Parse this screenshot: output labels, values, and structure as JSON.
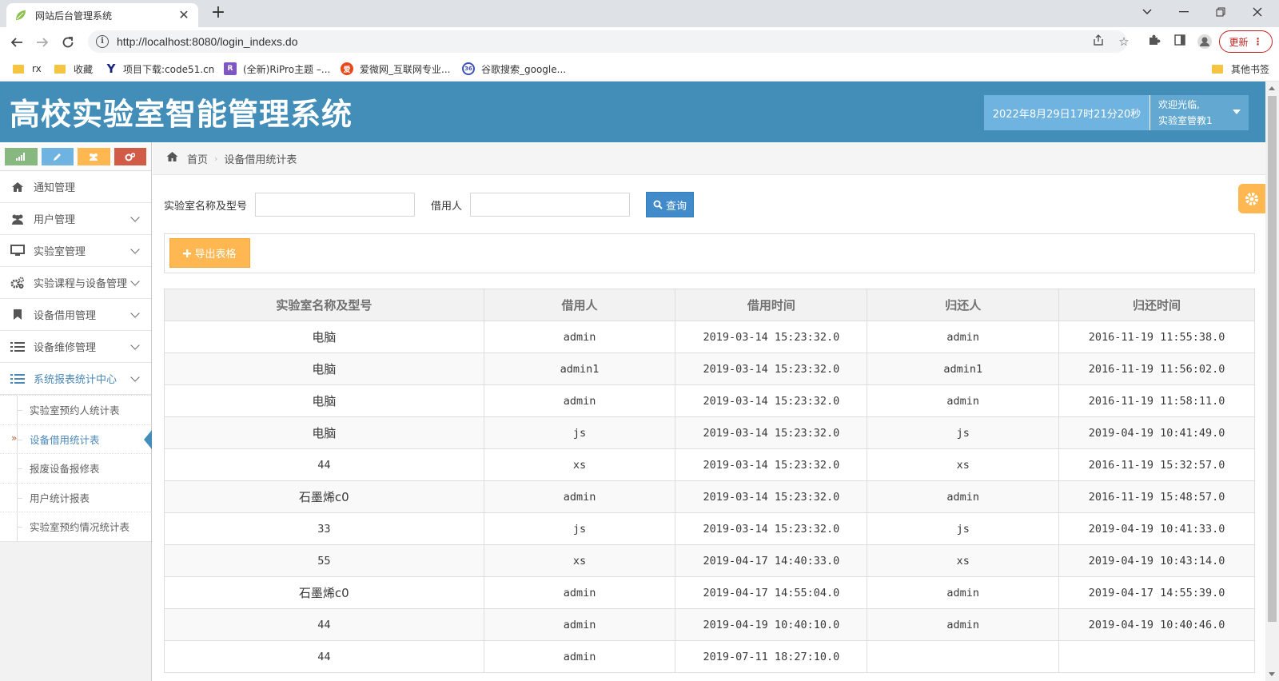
{
  "browser": {
    "tab_title": "网站后台管理系统",
    "url": "http://localhost:8080/login_indexs.do",
    "update_label": "更新",
    "bookmarks": [
      "rx",
      "收藏",
      "项目下载:code51.cn",
      "(全新)RiPro主题 –...",
      "爱微网_互联网专业...",
      "谷歌搜索_google..."
    ],
    "other_bookmarks": "其他书签"
  },
  "header": {
    "title": "高校实验室智能管理系统",
    "datetime": "2022年8月29日17时21分20秒",
    "welcome": "欢迎光临,",
    "username": "实验室管教1"
  },
  "sidebar": {
    "items": [
      {
        "label": "通知管理",
        "icon": "home-icon"
      },
      {
        "label": "用户管理",
        "icon": "users-icon"
      },
      {
        "label": "实验室管理",
        "icon": "desktop-icon"
      },
      {
        "label": "实验课程与设备管理",
        "icon": "gears-icon"
      },
      {
        "label": "设备借用管理",
        "icon": "bookmark-icon"
      },
      {
        "label": "设备维修管理",
        "icon": "list-icon"
      },
      {
        "label": "系统报表统计中心",
        "icon": "list-icon"
      }
    ],
    "sub_items": [
      "实验室预约人统计表",
      "设备借用统计表",
      "报废设备报修表",
      "用户统计报表",
      "实验室预约情况统计表"
    ],
    "active_sub": "设备借用统计表"
  },
  "breadcrumb": {
    "home": "首页",
    "current": "设备借用统计表"
  },
  "search": {
    "field1_label": "实验室名称及型号",
    "field1_value": "",
    "field2_label": "借用人",
    "field2_value": "",
    "button": "查询"
  },
  "export_label": "导出表格",
  "table": {
    "headers": [
      "实验室名称及型号",
      "借用人",
      "借用时间",
      "归还人",
      "归还时间"
    ],
    "rows": [
      [
        "电脑",
        "admin",
        "2019-03-14 15:23:32.0",
        "admin",
        "2016-11-19 11:55:38.0"
      ],
      [
        "电脑",
        "admin1",
        "2019-03-14 15:23:32.0",
        "admin1",
        "2016-11-19 11:56:02.0"
      ],
      [
        "电脑",
        "admin",
        "2019-03-14 15:23:32.0",
        "admin",
        "2016-11-19 11:58:11.0"
      ],
      [
        "电脑",
        "js",
        "2019-03-14 15:23:32.0",
        "js",
        "2019-04-19 10:41:49.0"
      ],
      [
        "44",
        "xs",
        "2019-03-14 15:23:32.0",
        "xs",
        "2016-11-19 15:32:57.0"
      ],
      [
        "石墨烯c0",
        "admin",
        "2019-03-14 15:23:32.0",
        "admin",
        "2016-11-19 15:48:57.0"
      ],
      [
        "33",
        "js",
        "2019-03-14 15:23:32.0",
        "js",
        "2019-04-19 10:41:33.0"
      ],
      [
        "55",
        "xs",
        "2019-04-17 14:40:33.0",
        "xs",
        "2019-04-19 10:43:14.0"
      ],
      [
        "石墨烯c0",
        "admin",
        "2019-04-17 14:55:04.0",
        "admin",
        "2019-04-17 14:55:39.0"
      ],
      [
        "44",
        "admin",
        "2019-04-19 10:40:10.0",
        "admin",
        "2019-04-19 10:40:46.0"
      ],
      [
        "44",
        "admin",
        "2019-07-11 18:27:10.0",
        "",
        ""
      ]
    ]
  },
  "colors": {
    "header_bg": "#438eb9",
    "primary_button": "#428bca",
    "warning_button": "#ffb752",
    "shortcut_success": "#87b87f",
    "shortcut_info": "#6fb3e0",
    "shortcut_warning": "#ffb752",
    "shortcut_danger": "#d15b47"
  }
}
